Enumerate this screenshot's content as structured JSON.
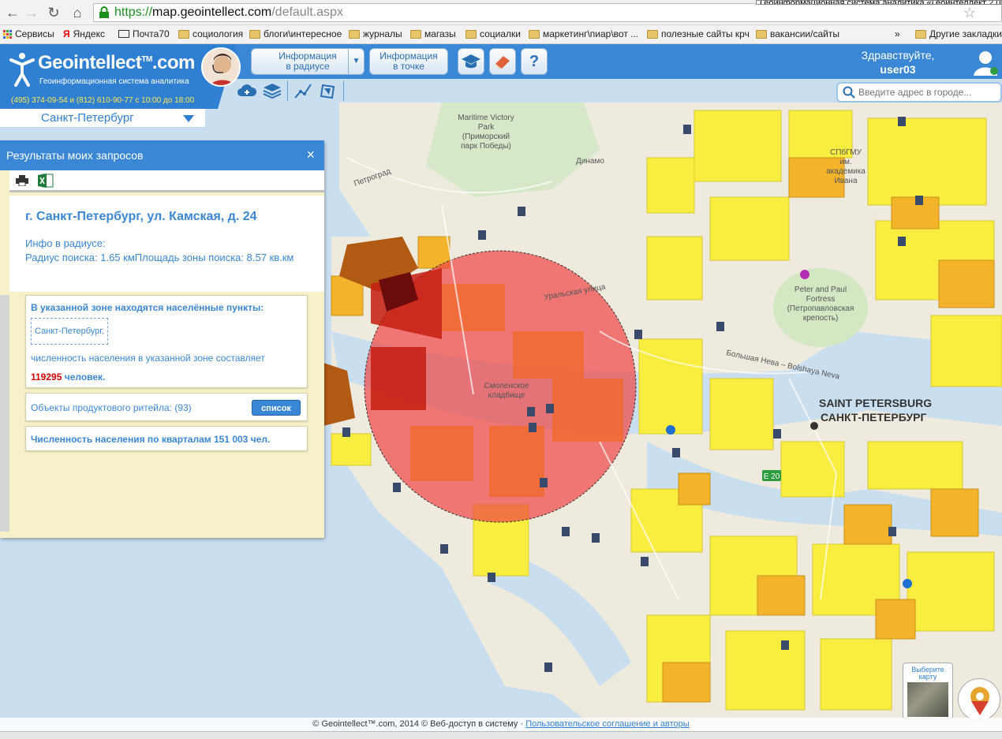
{
  "browser": {
    "tooltip": "Геоинформационная система аналитика «Геоинтеллект 2.0»",
    "url_scheme": "https://",
    "url_host": "map.geointellect.com",
    "url_path": "/default.aspx",
    "bookmarks": [
      {
        "label": "Сервисы",
        "icon": "apps-icon"
      },
      {
        "label": "Яндекс",
        "icon": "yandex-icon"
      },
      {
        "label": "Почта70",
        "icon": "mail-icon"
      },
      {
        "label": "социология",
        "icon": "folder-icon"
      },
      {
        "label": "блоги\\интересное",
        "icon": "folder-icon"
      },
      {
        "label": "журналы",
        "icon": "folder-icon"
      },
      {
        "label": "магазы",
        "icon": "folder-icon"
      },
      {
        "label": "социалки",
        "icon": "folder-icon"
      },
      {
        "label": "маркетинг\\пиар\\вот ...",
        "icon": "folder-icon"
      },
      {
        "label": "полезные сайты крч",
        "icon": "folder-icon"
      },
      {
        "label": "вакансии/сайты",
        "icon": "folder-icon"
      }
    ],
    "overflow": "»",
    "other_bookmarks": "Другие закладки"
  },
  "header": {
    "logo_title": "Geointellect",
    "logo_tm": "TM",
    "logo_domain": ".com",
    "logo_subtitle": "Геоинформационная система аналитика",
    "phone": "(495) 374-09-54 и (812) 610-90-77 с 10:00 до 18:00",
    "btn_radius_l1": "Информация",
    "btn_radius_l2": "в радиусе",
    "btn_point_l1": "Информация",
    "btn_point_l2": "в точке",
    "help_label": "?",
    "greeting": "Здравствуйте,",
    "username": "user03",
    "search_placeholder": "Введите адрес в городе...",
    "city": "Санкт-Петербург"
  },
  "results": {
    "title": "Результаты моих запросов",
    "close": "×",
    "address": "г. Санкт-Петербург, ул. Камская, д. 24",
    "info_l1": "Инфо в радиусе:",
    "info_l2": "Радиус поиска: 1.65 кмПлощадь зоны поиска: 8.57 кв.км",
    "settlements_label": "В указанной зоне находятся населённые пункты:",
    "settlement_chip": "Санкт-Петербург,",
    "population_label": "численность населения в указанной зоне составляет",
    "population_number": "119295",
    "population_unit": " человек.",
    "retail_label": "Объекты продуктового ритейла: (93)",
    "list_button": "список",
    "blocks_population": "Численность населения по кварталам 151 003 чел."
  },
  "map": {
    "labels": {
      "park_l1": "Maritime Victory",
      "park_l2": "Park",
      "park_l3": "(Приморский",
      "park_l4": "парк Победы)",
      "dinamo": "Динамо",
      "spbgmu_l1": "СПбГМУ",
      "spbgmu_l2": "им.",
      "spbgmu_l3": "академика",
      "spbgmu_l4": "Ивана",
      "fortress_l1": "Peter and Paul",
      "fortress_l2": "Fortress",
      "fortress_l3": "(Петропавловская",
      "fortress_l4": "крепость)",
      "cemetery_l1": "Смоленское",
      "cemetery_l2": "кладбище",
      "city_en": "SAINT PETERSBURG",
      "city_ru": "САНКТ-ПЕТЕРБУРГ",
      "petrograd": "Петроград",
      "neva": "Большая Нева – Bolshaya Neva",
      "street_1": "Уральская улица",
      "road_e": "E 20"
    },
    "colors": {
      "water": "#c9dff0",
      "land": "#f4f1e8",
      "yellow": "#f9ee3f",
      "orange": "#f3b42b",
      "circle": "#f04545"
    }
  },
  "footer": {
    "text": "© Geointellect™.com, 2014 © Веб-доступ в систему · ",
    "link": "Пользовательское соглашение и авторы"
  },
  "map_switch": {
    "label": "Выберите карту"
  }
}
